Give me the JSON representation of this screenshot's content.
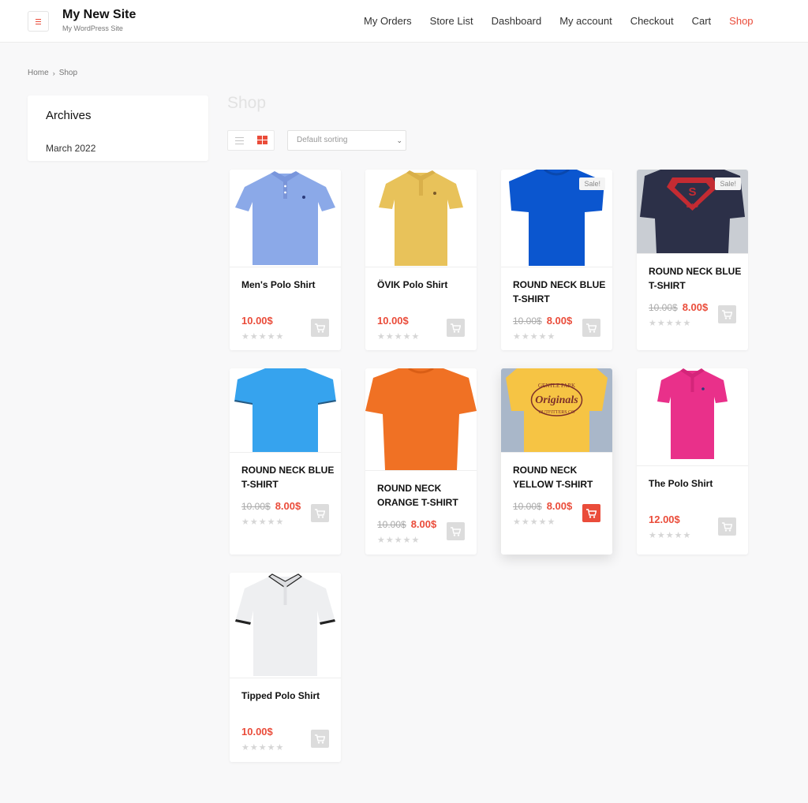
{
  "header": {
    "site_title": "My New Site",
    "tagline": "My WordPress Site",
    "nav": [
      "My Orders",
      "Store List",
      "Dashboard",
      "My account",
      "Checkout",
      "Cart",
      "Shop"
    ],
    "active_nav": "Shop"
  },
  "breadcrumb": {
    "home": "Home",
    "current": "Shop"
  },
  "sidebar": {
    "title": "Archives",
    "link": "March 2022"
  },
  "page": {
    "title": "Shop",
    "sort": "Default sorting"
  },
  "colors": {
    "accent": "#ea4c3a"
  },
  "products": [
    {
      "name": "Men's Polo Shirt",
      "price": "10.00$",
      "old_price": "",
      "sale": "",
      "rating": "★★★★★"
    },
    {
      "name": "ÖVIK Polo Shirt",
      "price": "10.00$",
      "old_price": "",
      "sale": "",
      "rating": "★★★★★"
    },
    {
      "name": "ROUND NECK BLUE T-SHIRT",
      "price": "8.00$",
      "old_price": "10.00$",
      "sale": "Sale!",
      "rating": "★★★★★"
    },
    {
      "name": "ROUND NECK BLUE T-SHIRT",
      "price": "8.00$",
      "old_price": "10.00$",
      "sale": "Sale!",
      "rating": "★★★★★"
    },
    {
      "name": "ROUND NECK BLUE T-SHIRT",
      "price": "8.00$",
      "old_price": "10.00$",
      "sale": "",
      "rating": "★★★★★"
    },
    {
      "name": "ROUND NECK ORANGE T-SHIRT",
      "price": "8.00$",
      "old_price": "10.00$",
      "sale": "",
      "rating": "★★★★★"
    },
    {
      "name": "ROUND NECK YELLOW T-SHIRT",
      "price": "8.00$",
      "old_price": "10.00$",
      "sale": "",
      "rating": "★★★★★"
    },
    {
      "name": "The Polo Shirt",
      "price": "12.00$",
      "old_price": "",
      "sale": "",
      "rating": "★★★★★"
    },
    {
      "name": "Tipped Polo Shirt",
      "price": "10.00$",
      "old_price": "",
      "sale": "",
      "rating": "★★★★★"
    }
  ]
}
